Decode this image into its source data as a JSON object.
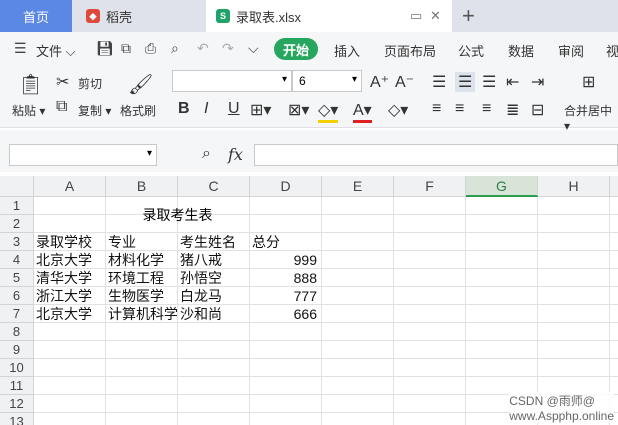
{
  "tabs": {
    "home": "首页",
    "daoke": "稻壳",
    "file": "录取表.xlsx"
  },
  "menu": {
    "file": "文件",
    "start": "开始",
    "insert": "插入",
    "layout": "页面布局",
    "formula": "公式",
    "data": "数据",
    "review": "审阅",
    "view": "视"
  },
  "ribbon": {
    "paste": "粘贴",
    "cut": "剪切",
    "copy": "复制",
    "painter": "格式刷",
    "font_size": "6",
    "merge": "合并居中"
  },
  "formula_bar": {
    "fx": "fx"
  },
  "columns": [
    "A",
    "B",
    "C",
    "D",
    "E",
    "F",
    "G",
    "H"
  ],
  "rows": [
    "1",
    "2",
    "3",
    "4",
    "5",
    "6",
    "7",
    "8",
    "9",
    "10",
    "11",
    "12",
    "13"
  ],
  "sheet": {
    "title": "录取考生表",
    "headers": [
      "录取学校",
      "专业",
      "考生姓名",
      "总分"
    ],
    "records": [
      [
        "北京大学",
        "材料化学",
        "猪八戒",
        "999"
      ],
      [
        "清华大学",
        "环境工程",
        "孙悟空",
        "888"
      ],
      [
        "浙江大学",
        "生物医学",
        "白龙马",
        "777"
      ],
      [
        "北京大学",
        "计算机科学",
        "沙和尚",
        "666"
      ]
    ]
  },
  "watermark": "CSDN @雨师@",
  "watermark2": "www.Aspphp.online"
}
